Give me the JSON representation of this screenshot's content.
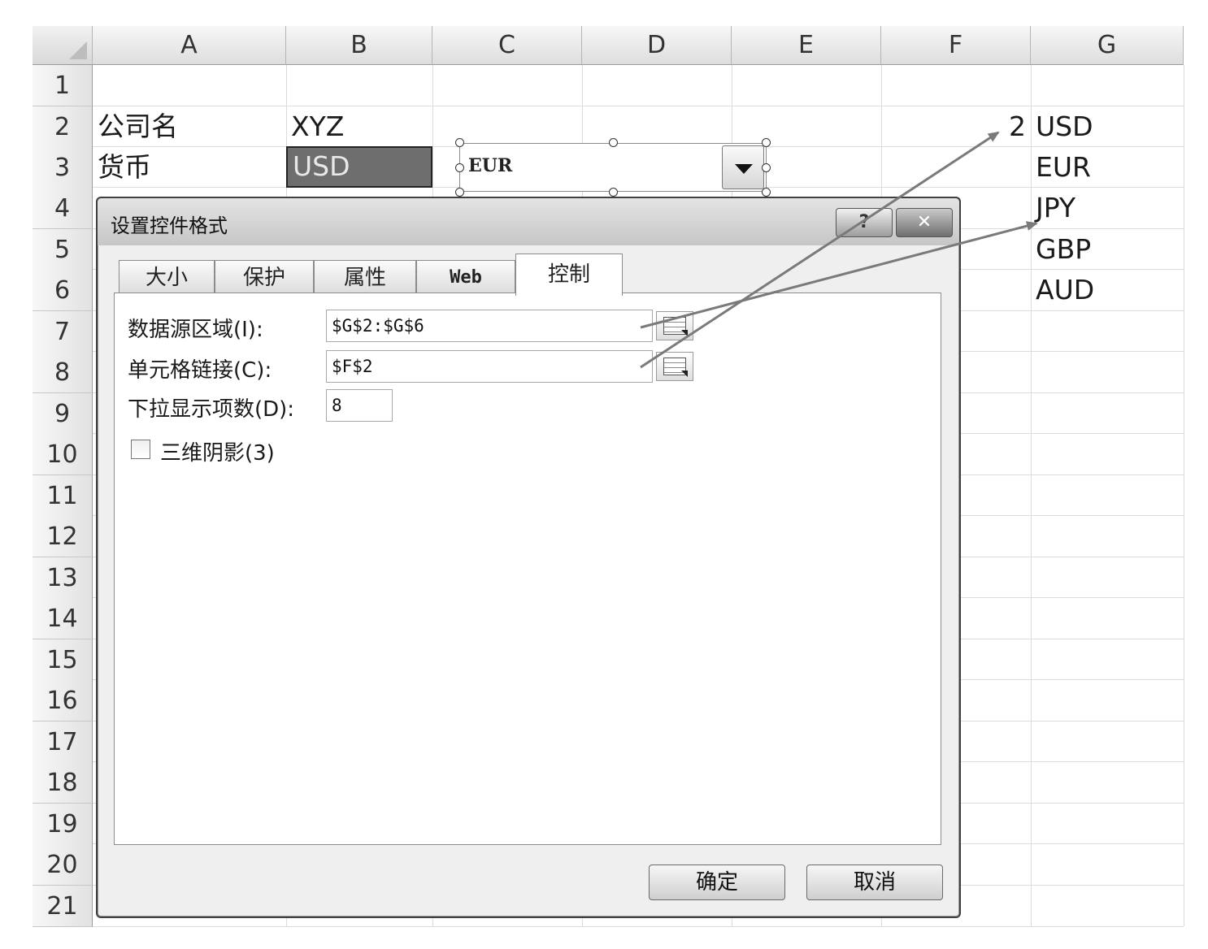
{
  "columns": [
    "A",
    "B",
    "C",
    "D",
    "E",
    "F",
    "G"
  ],
  "rows": [
    "1",
    "2",
    "3",
    "4",
    "5",
    "6",
    "7",
    "8",
    "9",
    "10",
    "11",
    "12",
    "13",
    "14",
    "15",
    "16",
    "17",
    "18",
    "19",
    "20",
    "21"
  ],
  "cells": {
    "a2": "公司名",
    "b2": "XYZ",
    "a3": "货币",
    "b3": "USD",
    "f2": "2",
    "g2": "USD",
    "g3": "EUR",
    "g4": "JPY",
    "g5": "GBP",
    "g6": "AUD"
  },
  "combo": {
    "value": "EUR"
  },
  "dialog": {
    "title": "设置控件格式",
    "help": "?",
    "close": "✕",
    "tabs": [
      "大小",
      "保护",
      "属性",
      "Web",
      "控制"
    ],
    "active_tab": "控制",
    "fields": {
      "input_range_label": "数据源区域(I):",
      "input_range_value": "$G$2:$G$6",
      "cell_link_label": "单元格链接(C):",
      "cell_link_value": "$F$2",
      "dropdown_lines_label": "下拉显示项数(D):",
      "dropdown_lines_value": "8",
      "shading_label": "三维阴影(3)"
    },
    "ok": "确定",
    "cancel": "取消"
  },
  "colors": {
    "selected_cell_fill": "#6e6e6e",
    "arrow": "#7a7a7a"
  }
}
